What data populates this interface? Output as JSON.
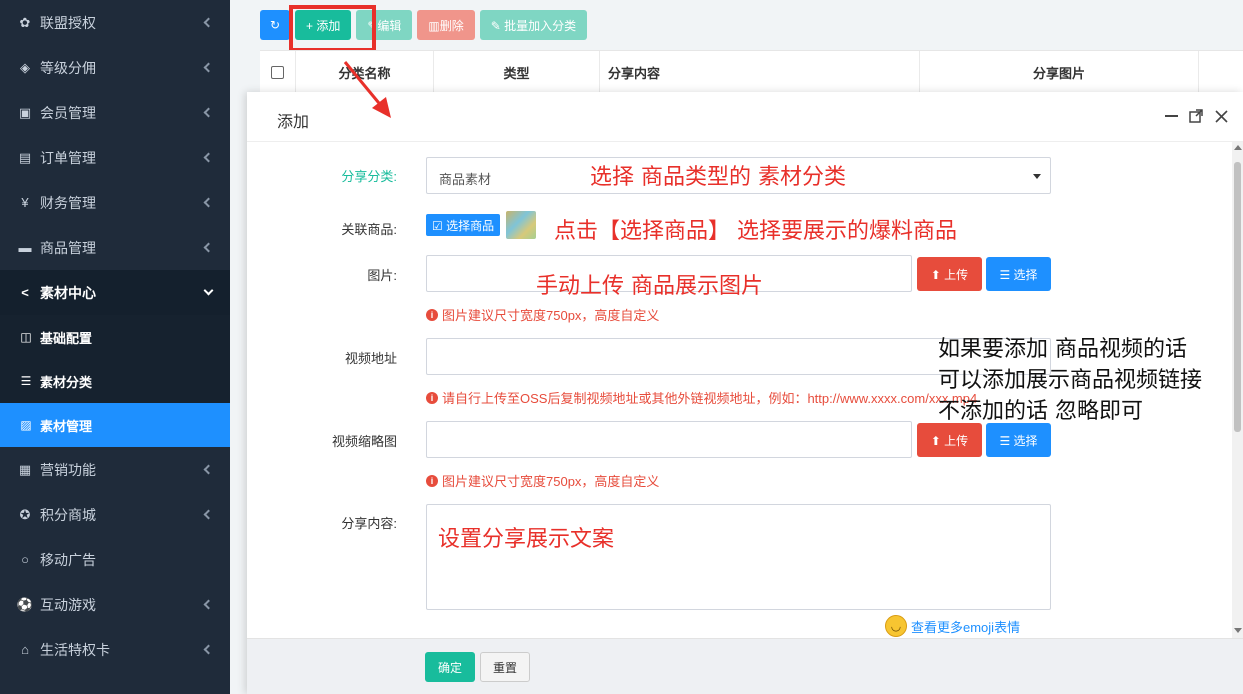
{
  "sidebar": {
    "items": [
      {
        "label": "联盟授权",
        "icon": "handshake-icon",
        "glyph": "✿"
      },
      {
        "label": "等级分佣",
        "icon": "diamond-icon",
        "glyph": "◈"
      },
      {
        "label": "会员管理",
        "icon": "member-card-icon",
        "glyph": "▣"
      },
      {
        "label": "订单管理",
        "icon": "order-copy-icon",
        "glyph": "▤"
      },
      {
        "label": "财务管理",
        "icon": "yen-icon",
        "glyph": "¥"
      },
      {
        "label": "商品管理",
        "icon": "briefcase-icon",
        "glyph": "▬"
      }
    ],
    "open_item": {
      "label": "素材中心",
      "icon": "share-icon",
      "glyph": "<"
    },
    "sub_items": [
      {
        "label": "基础配置",
        "icon": "columns-icon",
        "glyph": "◫"
      },
      {
        "label": "素材分类",
        "icon": "list-icon",
        "glyph": "☰"
      },
      {
        "label": "素材管理",
        "icon": "image-icon",
        "glyph": "▨"
      }
    ],
    "items_after": [
      {
        "label": "营销功能",
        "icon": "gift-icon",
        "glyph": "▦"
      },
      {
        "label": "积分商城",
        "icon": "star-circle-icon",
        "glyph": "✪"
      },
      {
        "label": "移动广告",
        "icon": "circle-icon",
        "glyph": "○"
      },
      {
        "label": "互动游戏",
        "icon": "soccer-ball-icon",
        "glyph": "⚽"
      },
      {
        "label": "生活特权卡",
        "icon": "home-icon",
        "glyph": "⌂"
      }
    ]
  },
  "toolbar": {
    "refresh_glyph": "↻",
    "add_label": "+ 添加",
    "edit_label": "✎编辑",
    "delete_label": "▥删除",
    "batch_label": "✎ 批量加入分类"
  },
  "table": {
    "headers": [
      "分类名称",
      "类型",
      "分享内容",
      "分享图片"
    ]
  },
  "modal": {
    "title": "添加",
    "category_label": "分享分类:",
    "category_value": "商品素材",
    "goods_label": "关联商品:",
    "select_goods_label": "☑ 选择商品",
    "image_label": "图片:",
    "upload_label": "⬆ 上传",
    "choose_label": "☰ 选择",
    "image_hint": "图片建议尺寸宽度750px，高度自定义",
    "video_label": "视频地址",
    "video_hint": "请自行上传至OSS后复制视频地址或其他外链视频地址，例如：http://www.xxxx.com/xxx.mp4",
    "thumb_label": "视频缩略图",
    "thumb_hint": "图片建议尺寸宽度750px，高度自定义",
    "content_label": "分享内容:",
    "emoji_link": "查看更多emoji表情",
    "confirm_label": "确定",
    "reset_label": "重置",
    "info_glyph": "i"
  },
  "annotations": {
    "category": "选择 商品类型的 素材分类",
    "goods": "点击【选择商品】 选择要展示的爆料商品",
    "image": "手动上传 商品展示图片",
    "video_lines": [
      "如果要添加 商品视频的话",
      "可以添加展示商品视频链接",
      "不添加的话 忽略即可"
    ],
    "content": "设置分享展示文案"
  },
  "colors": {
    "sidebar_bg": "#1f2b3a",
    "active_blue": "#1e90ff",
    "success_green": "#18bc9c",
    "danger_red": "#e74c3c",
    "annotation_red": "#e8302a"
  }
}
